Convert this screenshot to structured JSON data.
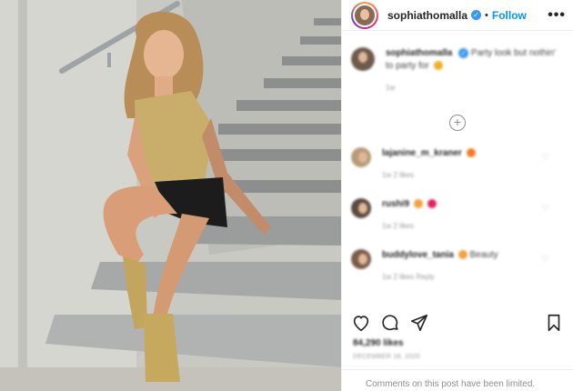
{
  "post": {
    "username": "sophiathomalla",
    "follow_label": "Follow",
    "more_label": "•••",
    "verified_mark": "✓",
    "dot": "•"
  },
  "caption": {
    "username": "sophiathomalla",
    "text": "Party look but nothin' to party for",
    "time": "1w"
  },
  "comments": [
    {
      "username": "lajanine_m_kraner",
      "text": "",
      "meta": "1w   2 likes"
    },
    {
      "username": "rushi9",
      "text": "",
      "meta": "1w   2 likes"
    },
    {
      "username": "buddylove_tania",
      "text": "Beauty",
      "meta": "1w   2 likes   Reply"
    }
  ],
  "load_more_label": "+",
  "likes": "84,290 likes",
  "date": "DECEMBER 18, 2020",
  "comments_limited": "Comments on this post have been limited.",
  "icons": {
    "heart": "heart-icon",
    "comment": "comment-icon",
    "share": "share-icon",
    "save": "bookmark-icon"
  },
  "colors": {
    "follow": "#0095f6",
    "verified": "#3897f0",
    "muted": "#8e8e8e"
  }
}
